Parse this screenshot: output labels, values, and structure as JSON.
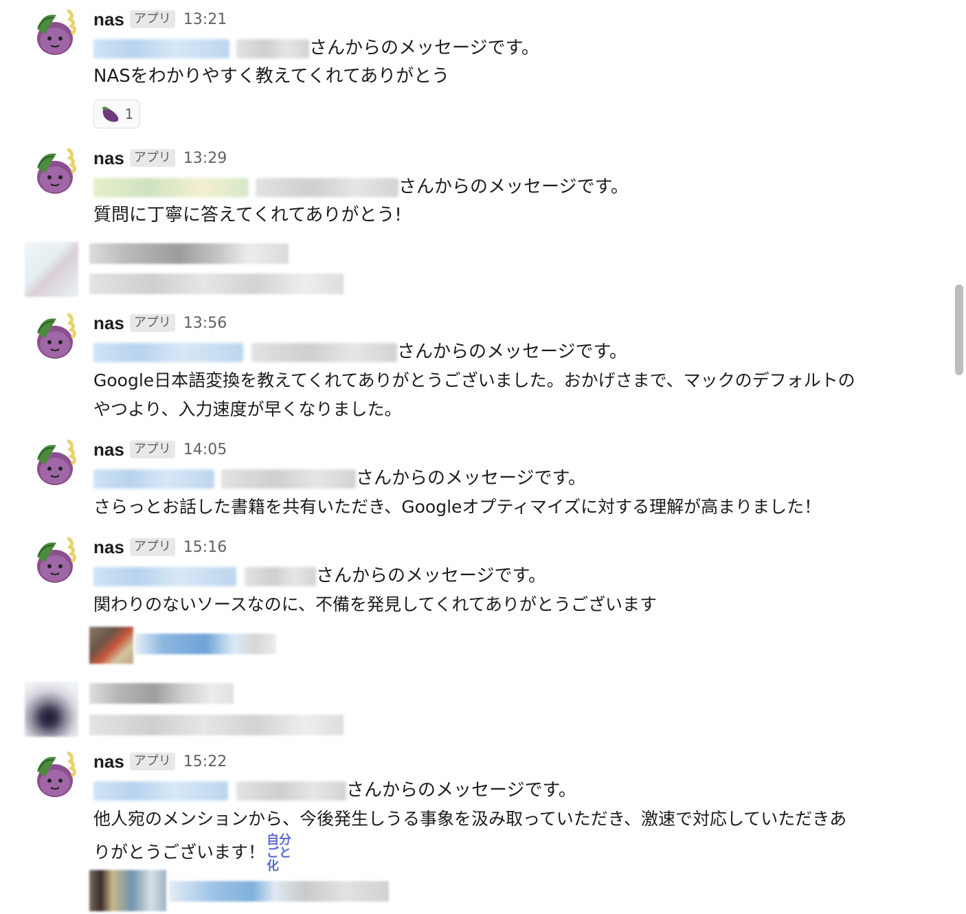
{
  "app_label": "アプリ",
  "sender": "nas",
  "suffix": "さんからのメッセージです。",
  "messages": [
    {
      "time": "13:21",
      "text": [
        "NASをわかりやすく教えてくれてありがとう"
      ],
      "reaction": {
        "emoji": "eggplant",
        "count": "1"
      }
    },
    {
      "time": "13:29",
      "text": [
        "質問に丁寧に答えてくれてありがとう!"
      ]
    },
    {
      "time": "13:56",
      "text": [
        "Google日本語変換を教えてくれてありがとうございました。おかげさまで、マックのデフォルトの",
        "やつより、入力速度が早くなりました。"
      ]
    },
    {
      "time": "14:05",
      "text": [
        "さらっとお話した書籍を共有いただき、Googleオプティマイズに対する理解が高まりました！"
      ]
    },
    {
      "time": "15:16",
      "text": [
        "関わりのないソースなのに、不備を発見してくれてありがとうございます"
      ]
    },
    {
      "time": "15:22",
      "text": [
        "他人宛のメンションから、今後発生しうる事象を汲み取っていただき、激速で対応していただきあ",
        "りがとうございます！"
      ],
      "inline_emoji": "自分ごと化"
    }
  ]
}
